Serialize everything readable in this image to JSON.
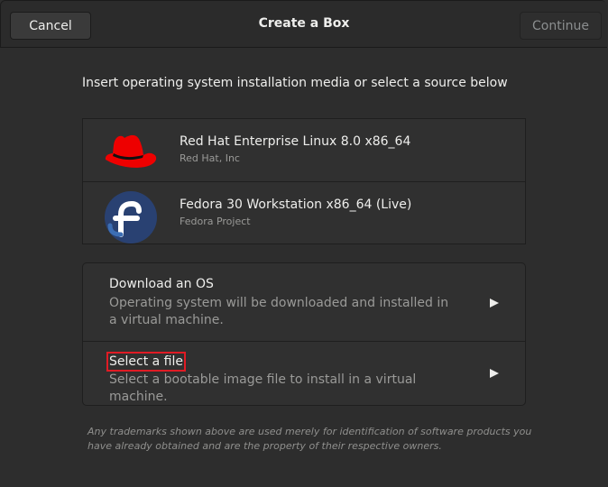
{
  "window": {
    "title": "Create a Box"
  },
  "header": {
    "cancel_label": "Cancel",
    "continue_label": "Continue"
  },
  "intro_text": "Insert operating system installation media or select a source below",
  "os_media": [
    {
      "name": "Red Hat Enterprise Linux 8.0 x86_64",
      "vendor": "Red Hat, Inc",
      "icon": "redhat-logo-icon"
    },
    {
      "name": "Fedora 30 Workstation x86_64 (Live)",
      "vendor": "Fedora Project",
      "icon": "fedora-logo-icon"
    }
  ],
  "sources": [
    {
      "title": "Download an OS",
      "description": "Operating system will be downloaded and installed in a virtual machine.",
      "icon": "arrow-right-icon"
    },
    {
      "title": "Select a file",
      "description": "Select a bootable image file to install in a virtual machine.",
      "icon": "arrow-right-icon"
    }
  ],
  "disclaimer": "Any trademarks shown above are used merely for identification of software products you have already obtained and are the property of their respective owners.",
  "colors": {
    "background": "#2d2d2d",
    "highlight": "#e01b24",
    "redhat": "#e00",
    "fedora": "#294172"
  }
}
